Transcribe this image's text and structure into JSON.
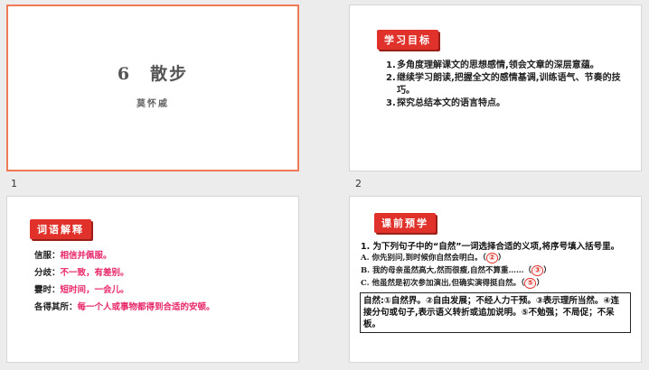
{
  "slides": [
    {
      "number": "1",
      "title": "6　散步",
      "author": "莫怀戚"
    },
    {
      "number": "2",
      "tag": "学习目标",
      "goals": [
        {
          "n": "1.",
          "text": "多角度理解课文的思想感情,领会文章的深层意蕴。"
        },
        {
          "n": "2.",
          "text": "继续学习朗读,把握全文的感情基调,训练语气、节奏的技巧。"
        },
        {
          "n": "3.",
          "text": "探究总结本文的语言特点。"
        }
      ]
    },
    {
      "number": "",
      "tag": "词语解释",
      "entries": [
        {
          "term": "信服：",
          "def": "相信并佩服。"
        },
        {
          "term": "分歧：",
          "def": "不一致，有差别。"
        },
        {
          "term": "霎时：",
          "def": "短时间，一会儿。"
        },
        {
          "term": "各得其所：",
          "def": "每一个人或事物都得到合适的安顿。"
        }
      ]
    },
    {
      "number": "",
      "tag": "课前预学",
      "question": "1. 为下列句子中的“自然”一词选择合适的义项,将序号填入括号里。",
      "items": [
        {
          "text": "A. 你先别问,到时候你自然会明白。（",
          "answer": "②",
          "end": "）"
        },
        {
          "text": "B. 我的母亲虽然高大,然而很瘦,自然不算重……（",
          "answer": "③",
          "end": "）"
        },
        {
          "text": "C. 他虽然是初次参加演出,但确实演得挺自然。（",
          "answer": "⑤",
          "end": "）"
        }
      ],
      "box_text": "自然:①自然界。②自由发展；不经人力干预。③表示理所当然。④连接分句或句子,表示语义转折或追加说明。⑤不勉强；不局促；不呆板。"
    }
  ]
}
